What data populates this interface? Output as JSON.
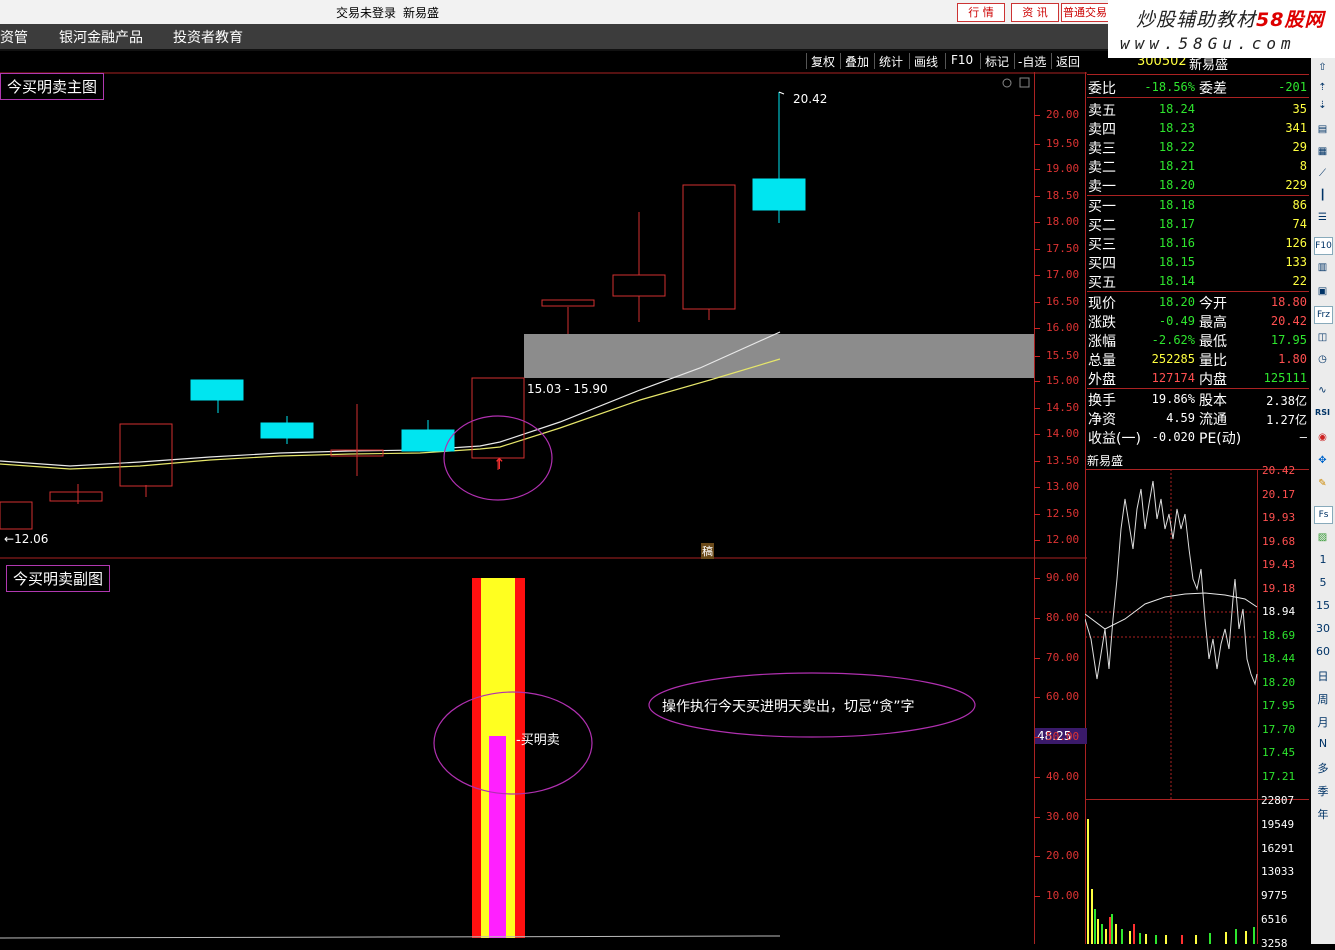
{
  "titlebar": {
    "status": "交易未登录",
    "stock_name": "新易盛",
    "btn_quote": "行 情",
    "btn_info": "资 讯",
    "btn_trade": "普通交易"
  },
  "logo": {
    "line1_a": "炒股辅助教材",
    "line1_b": "58股网",
    "line2": "www.58Gu.com"
  },
  "menu": {
    "items": [
      "财资管",
      "银河金融产品",
      "投资者教育"
    ]
  },
  "toolbar": {
    "items": [
      "复权",
      "叠加",
      "统计",
      "画线",
      "F10",
      "标记",
      "-自选",
      "返回"
    ]
  },
  "main_chart": {
    "title": "今买明卖主图",
    "axis": [
      "20.00",
      "19.50",
      "19.00",
      "18.50",
      "18.00",
      "17.50",
      "17.00",
      "16.50",
      "16.00",
      "15.50",
      "15.00",
      "14.50",
      "14.00",
      "13.50",
      "13.00",
      "12.50",
      "12.00"
    ],
    "high_label": "20.42",
    "low_label": "12.06",
    "zone_label": "15.03 - 15.90",
    "center_tag": "稿"
  },
  "sub_chart": {
    "title": "今买明卖副图",
    "axis": [
      "90.00",
      "80.00",
      "70.00",
      "60.00",
      "50.00",
      "40.00",
      "30.00",
      "20.00",
      "10.00"
    ],
    "signal_label": "买明卖",
    "note": "操作执行今天买进明天卖出，切忌“贪”字",
    "current_value": "48.25"
  },
  "quote": {
    "code": "300502",
    "name": "新易盛",
    "ratio_label": "委比",
    "ratio_value": "-18.56%",
    "diff_label": "委差",
    "diff_value": "-201",
    "asks": [
      {
        "label": "卖五",
        "price": "18.24",
        "vol": "35"
      },
      {
        "label": "卖四",
        "price": "18.23",
        "vol": "341"
      },
      {
        "label": "卖三",
        "price": "18.22",
        "vol": "29"
      },
      {
        "label": "卖二",
        "price": "18.21",
        "vol": "8"
      },
      {
        "label": "卖一",
        "price": "18.20",
        "vol": "229"
      }
    ],
    "bids": [
      {
        "label": "买一",
        "price": "18.18",
        "vol": "86"
      },
      {
        "label": "买二",
        "price": "18.17",
        "vol": "74"
      },
      {
        "label": "买三",
        "price": "18.16",
        "vol": "126"
      },
      {
        "label": "买四",
        "price": "18.15",
        "vol": "133"
      },
      {
        "label": "买五",
        "price": "18.14",
        "vol": "22"
      }
    ],
    "stats": [
      {
        "k1": "现价",
        "v1": "18.20",
        "c1": "green",
        "k2": "今开",
        "v2": "18.80",
        "c2": "red"
      },
      {
        "k1": "涨跌",
        "v1": "-0.49",
        "c1": "green",
        "k2": "最高",
        "v2": "20.42",
        "c2": "red"
      },
      {
        "k1": "涨幅",
        "v1": "-2.62%",
        "c1": "green",
        "k2": "最低",
        "v2": "17.95",
        "c2": "green"
      },
      {
        "k1": "总量",
        "v1": "252285",
        "c1": "yellow",
        "k2": "量比",
        "v2": "1.80",
        "c2": "red"
      },
      {
        "k1": "外盘",
        "v1": "127174",
        "c1": "red",
        "k2": "内盘",
        "v2": "125111",
        "c2": "green"
      }
    ],
    "stats2": [
      {
        "k1": "换手",
        "v1": "19.86%",
        "k2": "股本",
        "v2": "2.38亿"
      },
      {
        "k1": "净资",
        "v1": "4.59",
        "k2": "流通",
        "v2": "1.27亿"
      },
      {
        "k1": "收益(一)",
        "v1": "-0.020",
        "k2": "PE(动)",
        "v2": "—"
      }
    ]
  },
  "minichart": {
    "title": "新易盛",
    "price_axis": [
      "20.42",
      "20.17",
      "19.93",
      "19.68",
      "19.43",
      "19.18",
      "18.94",
      "18.69",
      "18.44",
      "18.20",
      "17.95",
      "17.70",
      "17.45",
      "17.21"
    ],
    "vol_axis": [
      "22807",
      "19549",
      "16291",
      "13033",
      "9775",
      "6516",
      "3258"
    ]
  },
  "iconcol": {
    "periods": [
      "1",
      "5",
      "15",
      "30",
      "60",
      "日",
      "周",
      "月",
      "N",
      "多",
      "季",
      "年"
    ],
    "small_btns": [
      "Fs",
      "RSI",
      "F10",
      "Frz"
    ]
  }
}
